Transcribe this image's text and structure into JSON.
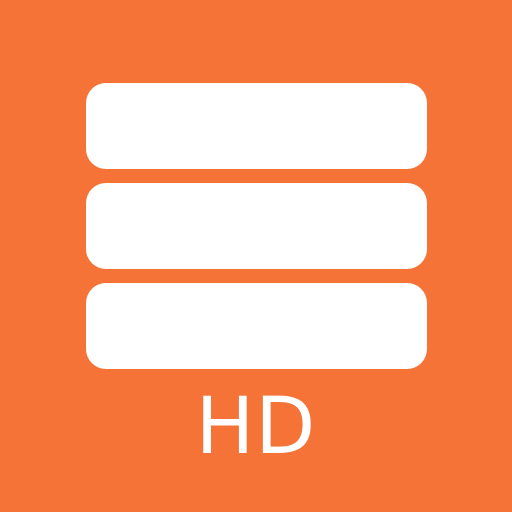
{
  "app_icon": {
    "label": "HD",
    "background_color": "#F57337",
    "foreground_color": "#FFFFFF",
    "icon_name": "stacked-bars-icon"
  }
}
